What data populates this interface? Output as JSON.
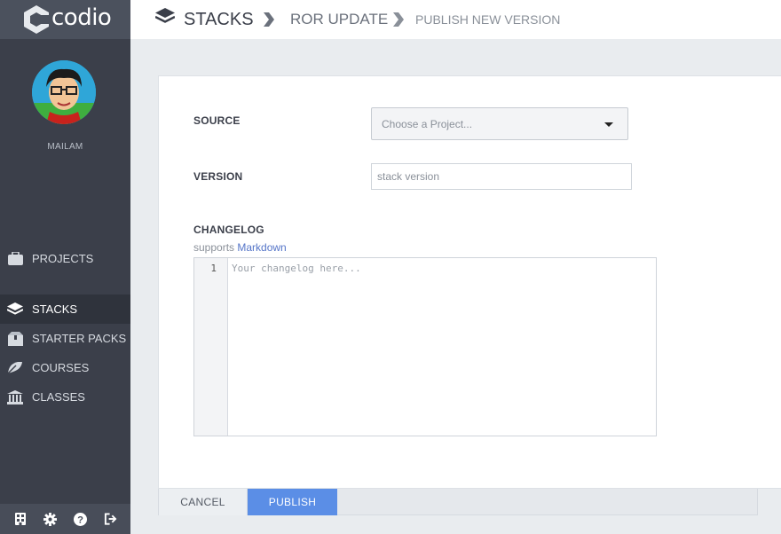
{
  "app": {
    "brand": "codio"
  },
  "user": {
    "name": "MAILAM"
  },
  "sidebar": {
    "items": [
      {
        "label": "PROJECTS",
        "icon": "briefcase-icon"
      },
      {
        "label": "STACKS",
        "icon": "layers-icon",
        "active": true
      },
      {
        "label": "STARTER PACKS",
        "icon": "box-icon"
      },
      {
        "label": "COURSES",
        "icon": "graduation-icon"
      },
      {
        "label": "CLASSES",
        "icon": "institution-icon"
      }
    ],
    "bottom_icons": [
      "building-icon",
      "gear-icon",
      "help-icon",
      "logout-icon"
    ]
  },
  "breadcrumb": {
    "root": "STACKS",
    "parent": "ROR UPDATE",
    "current": "PUBLISH NEW VERSION"
  },
  "form": {
    "source": {
      "label": "SOURCE",
      "value": "Choose a Project..."
    },
    "version": {
      "label": "VERSION",
      "placeholder": "stack version"
    },
    "changelog": {
      "label": "CHANGELOG",
      "supports_text": "supports",
      "markdown_link": "Markdown",
      "line_number": "1",
      "placeholder": "Your changelog here..."
    }
  },
  "actions": {
    "cancel": "CANCEL",
    "publish": "PUBLISH"
  },
  "colors": {
    "sidebar": "#3b3f4a",
    "active_nav": "#2f333c",
    "accent": "#5b8ee6",
    "link": "#5575c8"
  }
}
